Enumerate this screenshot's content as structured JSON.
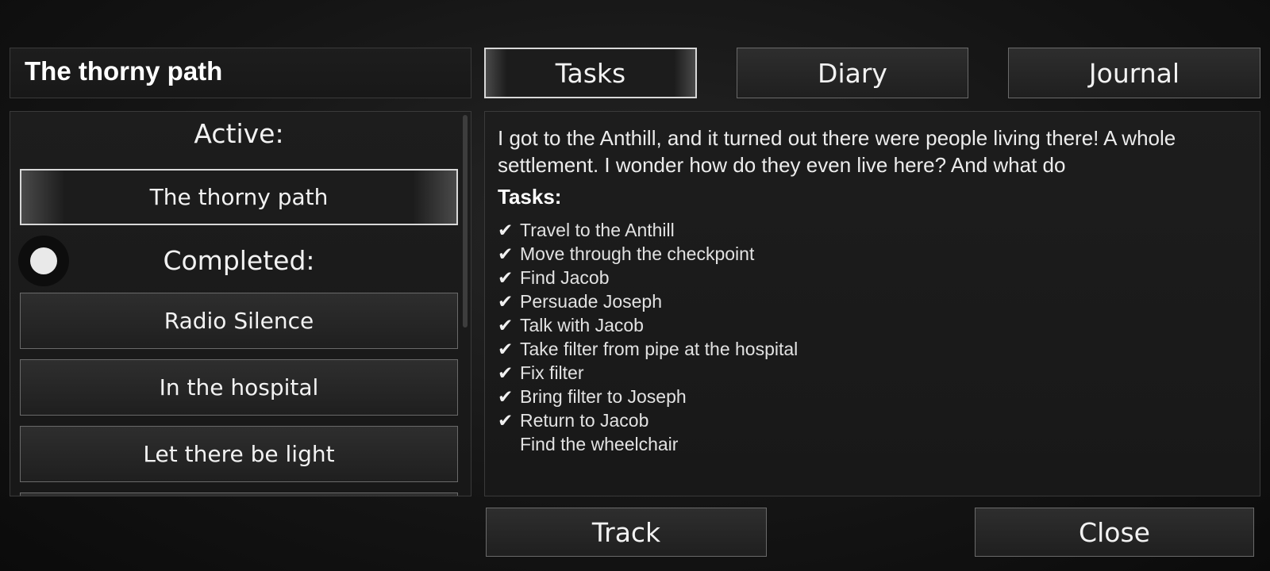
{
  "header": {
    "quest_title": "The thorny path"
  },
  "tabs": [
    "Tasks",
    "Diary",
    "Journal"
  ],
  "list": {
    "active_label": "Active:",
    "active_quest": "The thorny path",
    "completed_label": "Completed:",
    "completed_quests": [
      "Radio Silence",
      "In the hospital",
      "Let there be light",
      ""
    ]
  },
  "content": {
    "description": "I got to the Anthill, and it turned out there were people living there! A whole settlement. I wonder how do they even live here? And what do",
    "tasks_heading": "Tasks:",
    "check_glyph": "✔",
    "tasks": [
      {
        "text": "Travel to the Anthill",
        "done": true
      },
      {
        "text": "Move through the checkpoint",
        "done": true
      },
      {
        "text": "Find Jacob",
        "done": true
      },
      {
        "text": "Persuade Joseph",
        "done": true
      },
      {
        "text": "Talk with Jacob",
        "done": true
      },
      {
        "text": "Take filter from pipe at the hospital",
        "done": true
      },
      {
        "text": "Fix filter",
        "done": true
      },
      {
        "text": "Bring filter to Joseph",
        "done": true
      },
      {
        "text": "Return to Jacob",
        "done": true
      },
      {
        "text": "Find the wheelchair",
        "done": false
      }
    ]
  },
  "footer": {
    "track_label": "Track",
    "close_label": "Close"
  }
}
